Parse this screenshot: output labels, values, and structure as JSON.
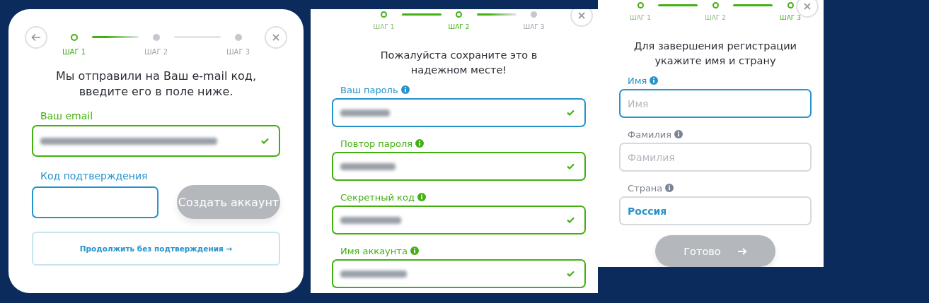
{
  "panels": [
    {
      "back_button": true,
      "close_button": true,
      "steps": [
        {
          "label": "ШАГ 1",
          "done": false,
          "current": true
        },
        {
          "label": "ШАГ 2",
          "done": false,
          "current": false
        },
        {
          "label": "ШАГ 3",
          "done": false,
          "current": false
        }
      ],
      "heading": [
        "Мы отправили на Ваш e-mail код,",
        "введите его в поле ниже."
      ],
      "fields": [
        {
          "label": "Ваш email",
          "focused": false,
          "valid": true,
          "redacted": true
        },
        {
          "label": "Код подтверждения",
          "focused": true,
          "valid": false,
          "button": {
            "label": "Создать аккаунт",
            "disabled": true
          }
        }
      ],
      "link_button": {
        "label": "Продолжить без подтверждения →"
      }
    },
    {
      "close_button": true,
      "steps": [
        {
          "label": "ШАГ 1",
          "done": true,
          "current": false
        },
        {
          "label": "ШАГ 2",
          "done": false,
          "current": true
        },
        {
          "label": "ШАГ 3",
          "done": false,
          "current": false
        }
      ],
      "heading": [
        "Пожалуйста сохраните это в",
        "надежном месте!"
      ],
      "fields": [
        {
          "label": "Ваш пароль",
          "info": true,
          "focused": true,
          "valid": true,
          "redacted": true
        },
        {
          "label": "Повтор пароля",
          "info": true,
          "focused": false,
          "valid": true,
          "redacted": true
        },
        {
          "label": "Секретный код",
          "info": true,
          "focused": false,
          "valid": true,
          "redacted": true
        },
        {
          "label": "Имя аккаунта",
          "info": true,
          "focused": false,
          "valid": true,
          "redacted": true
        }
      ]
    },
    {
      "close_button": true,
      "steps": [
        {
          "label": "ШАГ 1",
          "done": true,
          "current": false
        },
        {
          "label": "ШАГ 2",
          "done": true,
          "current": false
        },
        {
          "label": "ШАГ 3",
          "done": false,
          "current": true
        }
      ],
      "heading": [
        "Для завершения регистрации",
        "укажите имя и страну"
      ],
      "fields": [
        {
          "label": "Имя",
          "info": true,
          "focused": true,
          "valid": false,
          "placeholder": "Имя"
        },
        {
          "label": "Фамилия",
          "info": true,
          "focused": false,
          "valid": false,
          "placeholder": "Фамилия"
        },
        {
          "label": "Страна",
          "info": true,
          "focused": false,
          "valid": false,
          "value": "Россия"
        }
      ],
      "submit_button": {
        "label": "Готово",
        "disabled": true
      }
    }
  ]
}
